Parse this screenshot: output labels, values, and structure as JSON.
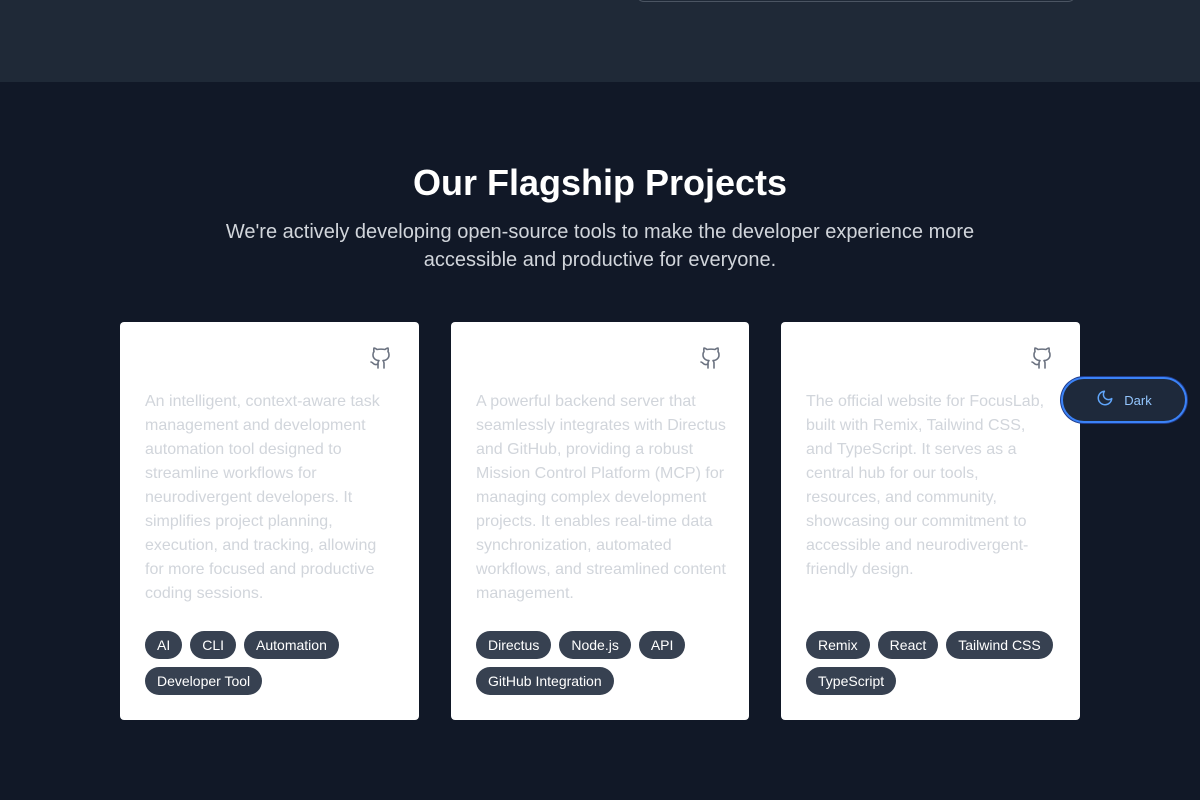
{
  "section": {
    "title": "Our Flagship Projects",
    "subtitle": "We're actively developing open-source tools to make the developer experience more accessible and productive for everyone."
  },
  "projects": [
    {
      "description": "An intelligent, context-aware task management and development automation tool designed to streamline workflows for neurodivergent developers. It simplifies project planning, execution, and tracking, allowing for more focused and productive coding sessions.",
      "tags": [
        "AI",
        "CLI",
        "Automation",
        "Developer Tool"
      ]
    },
    {
      "description": "A powerful backend server that seamlessly integrates with Directus and GitHub, providing a robust Mission Control Platform (MCP) for managing complex development projects. It enables real-time data synchronization, automated workflows, and streamlined content management.",
      "tags": [
        "Directus",
        "Node.js",
        "API",
        "GitHub Integration"
      ]
    },
    {
      "description": "The official website for FocusLab, built with Remix, Tailwind CSS, and TypeScript. It serves as a central hub for our tools, resources, and community, showcasing our commitment to accessible and neurodivergent-friendly design.",
      "tags": [
        "Remix",
        "React",
        "Tailwind CSS",
        "TypeScript"
      ]
    }
  ],
  "icons": {
    "repo": "github-icon",
    "theme": "moon-icon"
  },
  "theme_toggle": {
    "label": "Dark"
  },
  "colors": {
    "page_background": "#111827",
    "header_band": "#1f2937",
    "card_background": "#ffffff",
    "tag_background": "#374151",
    "accent": "#3b82f6"
  }
}
